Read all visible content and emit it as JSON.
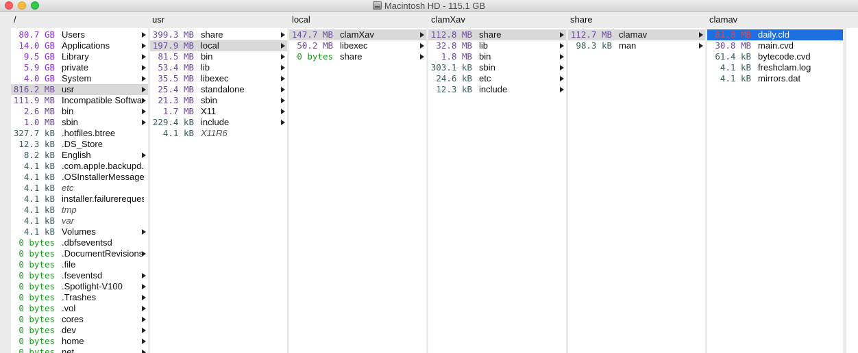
{
  "window": {
    "title": "Macintosh HD - 115.1 GB",
    "icon": "hard-disk-icon"
  },
  "colors": {
    "gb": "#8a2fd0",
    "mb": "#6b4a9a",
    "kb": "#3c5e5e",
    "bytes": "#1d9a1d",
    "selection": "#1b6fe0",
    "highlight": "#d9d9d9"
  },
  "columns": [
    {
      "header": "/",
      "items": [
        {
          "size": "80.7 GB",
          "name": "Users",
          "unit": "gb",
          "dir": true
        },
        {
          "size": "14.0 GB",
          "name": "Applications",
          "unit": "gb",
          "dir": true
        },
        {
          "size": "9.5 GB",
          "name": "Library",
          "unit": "gb",
          "dir": true
        },
        {
          "size": "5.9 GB",
          "name": "private",
          "unit": "gb",
          "dir": true
        },
        {
          "size": "4.0 GB",
          "name": "System",
          "unit": "gb",
          "dir": true
        },
        {
          "size": "816.2 MB",
          "name": "usr",
          "unit": "mb",
          "dir": true,
          "state": "hl"
        },
        {
          "size": "111.9 MB",
          "name": "Incompatible Software",
          "unit": "mb",
          "dir": true
        },
        {
          "size": "2.6 MB",
          "name": "bin",
          "unit": "mb",
          "dir": true
        },
        {
          "size": "1.0 MB",
          "name": "sbin",
          "unit": "mb",
          "dir": true
        },
        {
          "size": "327.7 kB",
          "name": ".hotfiles.btree",
          "unit": "kb",
          "dir": false
        },
        {
          "size": "12.3 kB",
          "name": ".DS_Store",
          "unit": "kb",
          "dir": false
        },
        {
          "size": "8.2 kB",
          "name": "English",
          "unit": "kb",
          "dir": true
        },
        {
          "size": "4.1 kB",
          "name": ".com.apple.backupd.",
          "unit": "kb",
          "dir": false
        },
        {
          "size": "4.1 kB",
          "name": ".OSInstallerMessages",
          "unit": "kb",
          "dir": false
        },
        {
          "size": "4.1 kB",
          "name": "etc",
          "unit": "kb",
          "dir": false,
          "italic": true
        },
        {
          "size": "4.1 kB",
          "name": "installer.failurerequests",
          "unit": "kb",
          "dir": false
        },
        {
          "size": "4.1 kB",
          "name": "tmp",
          "unit": "kb",
          "dir": false,
          "italic": true
        },
        {
          "size": "4.1 kB",
          "name": "var",
          "unit": "kb",
          "dir": false,
          "italic": true
        },
        {
          "size": "4.1 kB",
          "name": "Volumes",
          "unit": "kb",
          "dir": true
        },
        {
          "size": "0 bytes",
          "name": ".dbfseventsd",
          "unit": "b",
          "dir": false
        },
        {
          "size": "0 bytes",
          "name": ".DocumentRevisions",
          "unit": "b",
          "dir": true
        },
        {
          "size": "0 bytes",
          "name": ".file",
          "unit": "b",
          "dir": false
        },
        {
          "size": "0 bytes",
          "name": ".fseventsd",
          "unit": "b",
          "dir": true
        },
        {
          "size": "0 bytes",
          "name": ".Spotlight-V100",
          "unit": "b",
          "dir": true
        },
        {
          "size": "0 bytes",
          "name": ".Trashes",
          "unit": "b",
          "dir": true
        },
        {
          "size": "0 bytes",
          "name": ".vol",
          "unit": "b",
          "dir": true
        },
        {
          "size": "0 bytes",
          "name": "cores",
          "unit": "b",
          "dir": true
        },
        {
          "size": "0 bytes",
          "name": "dev",
          "unit": "b",
          "dir": true
        },
        {
          "size": "0 bytes",
          "name": "home",
          "unit": "b",
          "dir": true
        },
        {
          "size": "0 bytes",
          "name": "net",
          "unit": "b",
          "dir": true
        }
      ]
    },
    {
      "header": "usr",
      "items": [
        {
          "size": "399.3 MB",
          "name": "share",
          "unit": "mb",
          "dir": true
        },
        {
          "size": "197.9 MB",
          "name": "local",
          "unit": "mb",
          "dir": true,
          "state": "hl"
        },
        {
          "size": "81.5 MB",
          "name": "bin",
          "unit": "mb",
          "dir": true
        },
        {
          "size": "53.4 MB",
          "name": "lib",
          "unit": "mb",
          "dir": true
        },
        {
          "size": "35.5 MB",
          "name": "libexec",
          "unit": "mb",
          "dir": true
        },
        {
          "size": "25.4 MB",
          "name": "standalone",
          "unit": "mb",
          "dir": true
        },
        {
          "size": "21.3 MB",
          "name": "sbin",
          "unit": "mb",
          "dir": true
        },
        {
          "size": "1.7 MB",
          "name": "X11",
          "unit": "mb",
          "dir": true
        },
        {
          "size": "229.4 kB",
          "name": "include",
          "unit": "kb",
          "dir": true
        },
        {
          "size": "4.1 kB",
          "name": "X11R6",
          "unit": "kb",
          "dir": false,
          "italic": true
        }
      ]
    },
    {
      "header": "local",
      "items": [
        {
          "size": "147.7 MB",
          "name": "clamXav",
          "unit": "mb",
          "dir": true,
          "state": "hl"
        },
        {
          "size": "50.2 MB",
          "name": "libexec",
          "unit": "mb",
          "dir": true
        },
        {
          "size": "0 bytes",
          "name": "share",
          "unit": "b",
          "dir": true
        }
      ]
    },
    {
      "header": "clamXav",
      "items": [
        {
          "size": "112.8 MB",
          "name": "share",
          "unit": "mb",
          "dir": true,
          "state": "hl"
        },
        {
          "size": "32.8 MB",
          "name": "lib",
          "unit": "mb",
          "dir": true
        },
        {
          "size": "1.8 MB",
          "name": "bin",
          "unit": "mb",
          "dir": true
        },
        {
          "size": "303.1 kB",
          "name": "sbin",
          "unit": "kb",
          "dir": true
        },
        {
          "size": "24.6 kB",
          "name": "etc",
          "unit": "kb",
          "dir": true
        },
        {
          "size": "12.3 kB",
          "name": "include",
          "unit": "kb",
          "dir": true
        }
      ]
    },
    {
      "header": "share",
      "items": [
        {
          "size": "112.7 MB",
          "name": "clamav",
          "unit": "mb",
          "dir": true,
          "state": "hl"
        },
        {
          "size": "98.3 kB",
          "name": "man",
          "unit": "kb",
          "dir": true
        }
      ]
    },
    {
      "header": "clamav",
      "items": [
        {
          "size": "81.8 MB",
          "name": "daily.cld",
          "unit": "mb",
          "dir": false,
          "state": "sel"
        },
        {
          "size": "30.8 MB",
          "name": "main.cvd",
          "unit": "mb",
          "dir": false
        },
        {
          "size": "61.4 kB",
          "name": "bytecode.cvd",
          "unit": "kb",
          "dir": false
        },
        {
          "size": "4.1 kB",
          "name": "freshclam.log",
          "unit": "kb",
          "dir": false
        },
        {
          "size": "4.1 kB",
          "name": "mirrors.dat",
          "unit": "kb",
          "dir": false
        }
      ]
    }
  ]
}
